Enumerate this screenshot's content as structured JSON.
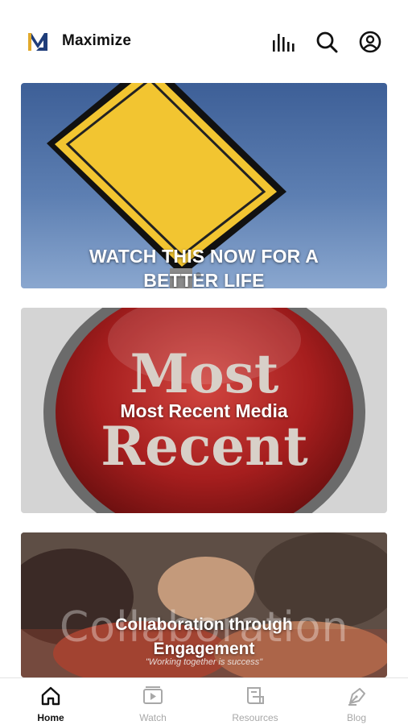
{
  "app": {
    "name": "Maximize"
  },
  "header": {
    "icons": [
      "stats-icon",
      "search-icon",
      "account-icon"
    ]
  },
  "cards": [
    {
      "title": "WATCH THIS NOW FOR A BETTER LIFE",
      "image": "fresh-perspective-sign"
    },
    {
      "title": "Most Recent Media",
      "image": "most-recent-button"
    },
    {
      "title": "Collaboration through Engagement",
      "image": "hands-together-photo",
      "image_text": "Collaboration",
      "caption": "\"Working together is success\""
    }
  ],
  "tabs": [
    {
      "label": "Home",
      "icon": "home-icon",
      "active": true
    },
    {
      "label": "Watch",
      "icon": "watch-icon",
      "active": false
    },
    {
      "label": "Resources",
      "icon": "resources-icon",
      "active": false
    },
    {
      "label": "Blog",
      "icon": "blog-icon",
      "active": false
    }
  ],
  "colors": {
    "accent_blue": "#1f3d7a",
    "accent_gold": "#e2a92b",
    "text": "#111111",
    "inactive": "#a8a8a8"
  }
}
